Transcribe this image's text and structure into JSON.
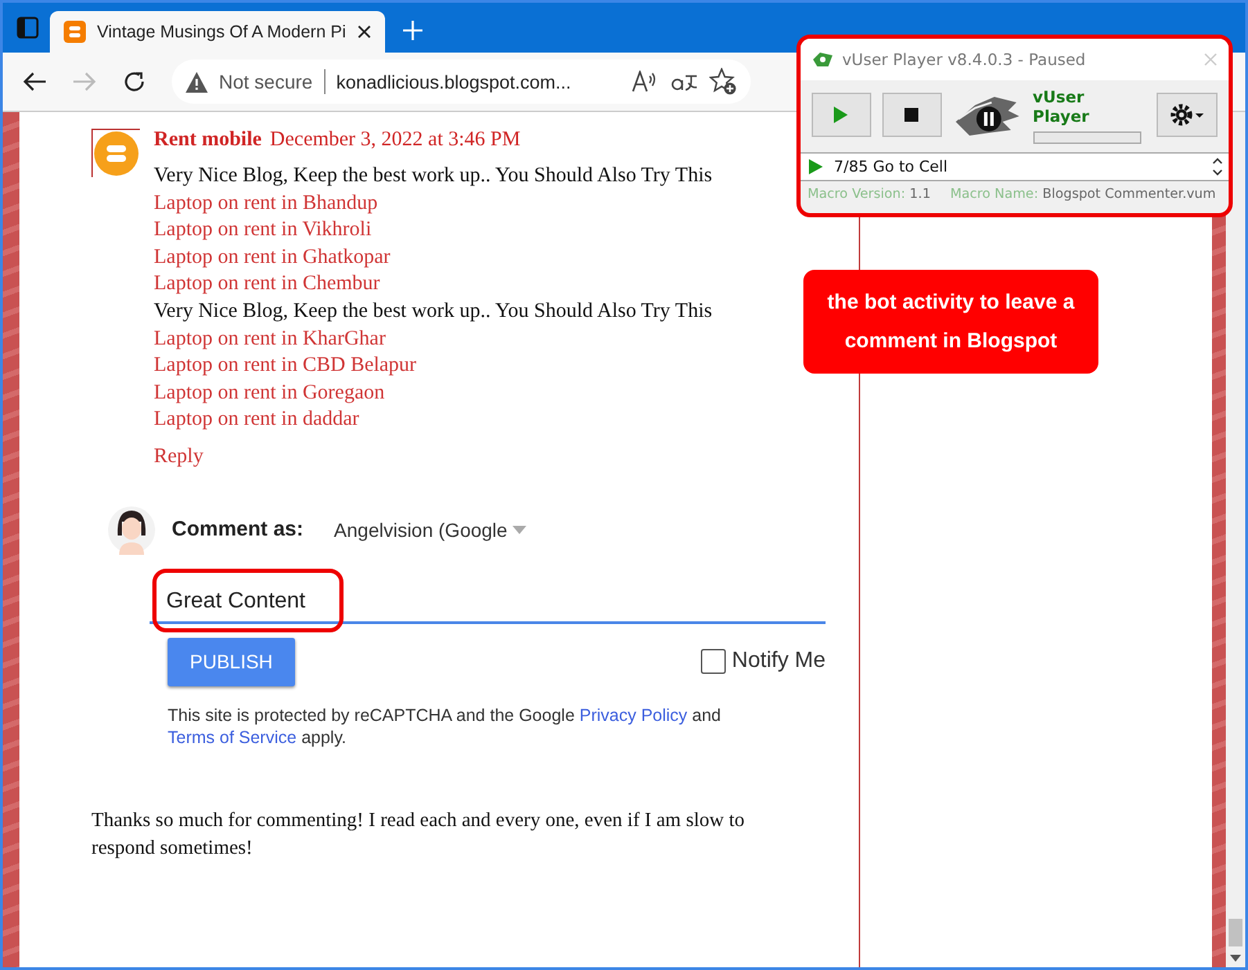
{
  "browser": {
    "tab": {
      "title": "Vintage Musings Of A Modern Pi",
      "selected": true
    },
    "security": "Not secure",
    "url": "konadlicious.blogspot.com..."
  },
  "comment": {
    "author": "Rent mobile",
    "date": "December 3, 2022 at 3:46 PM",
    "lines": [
      {
        "kind": "text",
        "text": "Very Nice Blog, Keep the best work up.. You Should Also Try This"
      },
      {
        "kind": "link",
        "text": "Laptop on rent in Bhandup"
      },
      {
        "kind": "link",
        "text": "Laptop on rent in Vikhroli"
      },
      {
        "kind": "link",
        "text": "Laptop on rent in Ghatkopar"
      },
      {
        "kind": "link",
        "text": "Laptop on rent in Chembur"
      },
      {
        "kind": "text",
        "text": "Very Nice Blog, Keep the best work up.. You Should Also Try This"
      },
      {
        "kind": "link",
        "text": "Laptop on rent in KharGhar"
      },
      {
        "kind": "link",
        "text": "Laptop on rent in CBD Belapur"
      },
      {
        "kind": "link",
        "text": "Laptop on rent in Goregaon"
      },
      {
        "kind": "link",
        "text": "Laptop on rent in daddar"
      }
    ],
    "reply": "Reply"
  },
  "comment_form": {
    "label": "Comment as:",
    "account": "Angelvision (Google",
    "value": "Great Content",
    "publish": "PUBLISH",
    "notify": {
      "label": "Notify Me",
      "checked": false
    },
    "notice": {
      "text": "This site is protected by reCAPTCHA and the Google",
      "privacy": "Privacy Policy",
      "and": "and",
      "terms": "Terms of Service",
      "end": "apply."
    }
  },
  "footer_note": "Thanks so much for commenting! I read each and every one, even if I am slow to respond sometimes!",
  "player": {
    "title": "vUser Player v8.4.0.3 - Paused",
    "brand": "vUser Player",
    "level": 0,
    "step": "7/85 Go to Cell",
    "version_label": "Macro Version:",
    "version": "1.1",
    "name_label": "Macro Name:",
    "name": "Blogspot Commenter.vum"
  },
  "callout": "the bot activity to leave a comment in Blogspot"
}
